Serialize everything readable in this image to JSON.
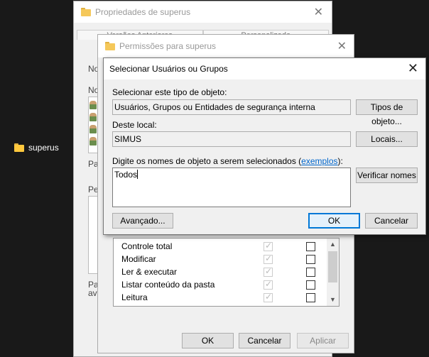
{
  "desktop": {
    "folder_label": "superus"
  },
  "props_window": {
    "title": "Propriedades de superus",
    "tabs": [
      "Versões Anteriores",
      "Personalizado"
    ],
    "frag_labels": [
      "No",
      "No",
      "Pa",
      "Pe",
      "Pa",
      "ava"
    ]
  },
  "perm_window": {
    "title": "Permissões para superus",
    "permissions": [
      {
        "name": "Controle total",
        "allow": true,
        "deny": false
      },
      {
        "name": "Modificar",
        "allow": true,
        "deny": false
      },
      {
        "name": "Ler & executar",
        "allow": true,
        "deny": false
      },
      {
        "name": "Listar conteúdo da pasta",
        "allow": true,
        "deny": false
      },
      {
        "name": "Leitura",
        "allow": true,
        "deny": false
      }
    ],
    "buttons": {
      "ok": "OK",
      "cancel": "Cancelar",
      "apply": "Aplicar"
    }
  },
  "dialog": {
    "title": "Selecionar Usuários ou Grupos",
    "object_type_label": "Selecionar este tipo de objeto:",
    "object_type_value": "Usuários, Grupos ou Entidades de segurança interna",
    "object_types_button": "Tipos de objeto...",
    "location_label": "Deste local:",
    "location_value": "SIMUS",
    "locations_button": "Locais...",
    "names_label_prefix": "Digite os nomes de objeto a serem selecionados (",
    "names_label_link": "exemplos",
    "names_label_suffix": "):",
    "names_value": "Todos",
    "check_names_button": "Verificar nomes",
    "advanced_button": "Avançado...",
    "ok_button": "OK",
    "cancel_button": "Cancelar"
  },
  "colors": {
    "accent": "#0078d7",
    "link": "#0066cc",
    "desktop_bg": "#191919"
  },
  "icons": {
    "folder": "folder-icon",
    "close": "close-icon",
    "user": "user-icon",
    "scroll_up": "chevron-up-icon",
    "scroll_down": "chevron-down-icon"
  }
}
